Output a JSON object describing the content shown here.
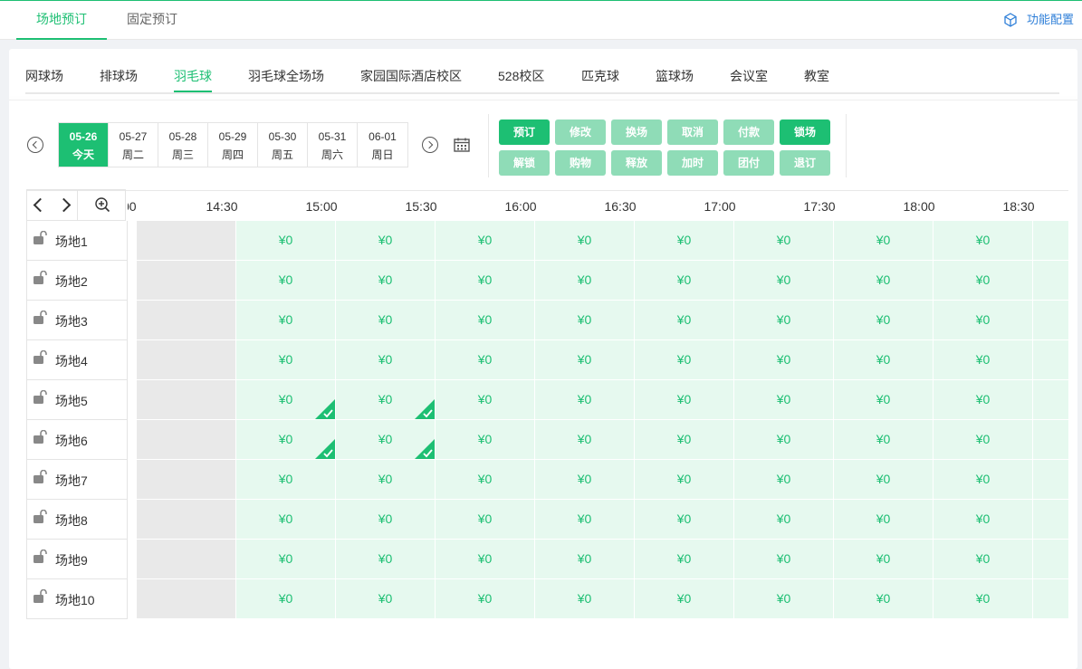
{
  "top_tabs": [
    "场地预订",
    "固定预订"
  ],
  "function_config": "功能配置",
  "venue_tabs": [
    "网球场",
    "排球场",
    "羽毛球",
    "羽毛球全场场",
    "家园国际酒店校区",
    "528校区",
    "匹克球",
    "篮球场",
    "会议室",
    "教室"
  ],
  "active_venue": "羽毛球",
  "dates": [
    {
      "date": "05-26",
      "weekday": "今天"
    },
    {
      "date": "05-27",
      "weekday": "周二"
    },
    {
      "date": "05-28",
      "weekday": "周三"
    },
    {
      "date": "05-29",
      "weekday": "周四"
    },
    {
      "date": "05-30",
      "weekday": "周五"
    },
    {
      "date": "05-31",
      "weekday": "周六"
    },
    {
      "date": "06-01",
      "weekday": "周日"
    }
  ],
  "actions_row1": [
    "预订",
    "修改",
    "换场",
    "取消",
    "付款",
    "锁场"
  ],
  "actions_row2": [
    "解锁",
    "购物",
    "释放",
    "加时",
    "团付",
    "退订"
  ],
  "times": [
    "00",
    "14:30",
    "15:00",
    "15:30",
    "16:00",
    "16:30",
    "17:00",
    "17:30",
    "18:00",
    "18:30"
  ],
  "courts": [
    "场地1",
    "场地2",
    "场地3",
    "场地4",
    "场地5",
    "场地6",
    "场地7",
    "场地8",
    "场地9",
    "场地10"
  ],
  "price_label": "¥0",
  "colors": {
    "accent": "#1dbf73",
    "slot_bg": "#e6f9ef",
    "past_bg": "#e9e9e9",
    "link": "#2f7fd8"
  }
}
